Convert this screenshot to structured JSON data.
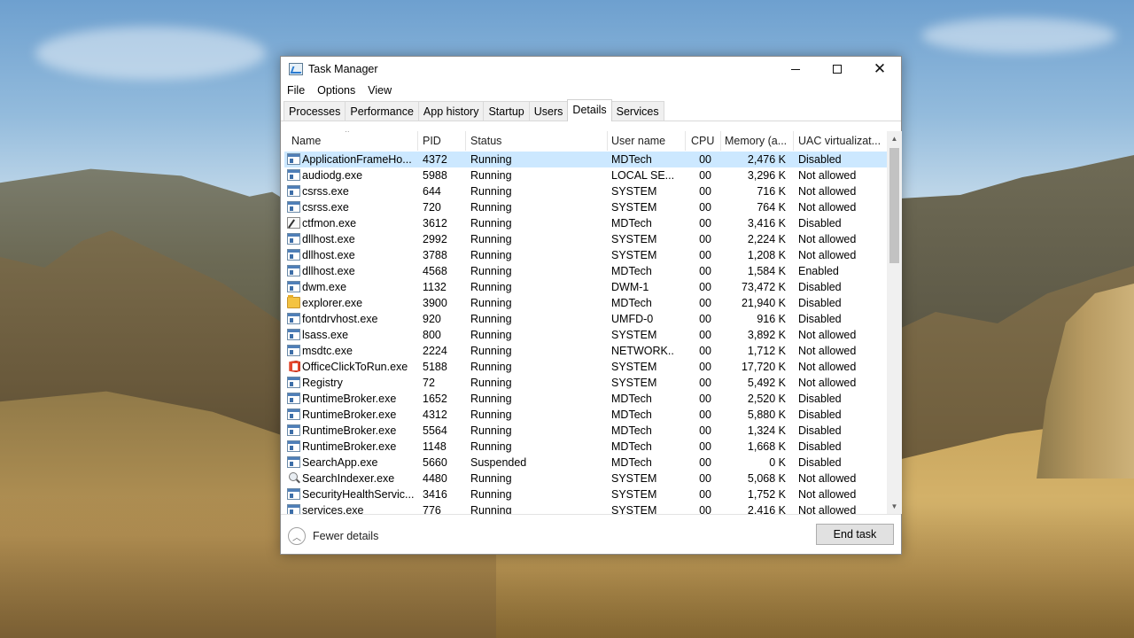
{
  "window": {
    "title": "Task Manager",
    "controls": {
      "minimize": "—",
      "maximize": "☐",
      "close": "✕"
    }
  },
  "menu": [
    "File",
    "Options",
    "View"
  ],
  "tabs": [
    {
      "label": "Processes",
      "active": false
    },
    {
      "label": "Performance",
      "active": false
    },
    {
      "label": "App history",
      "active": false
    },
    {
      "label": "Startup",
      "active": false
    },
    {
      "label": "Users",
      "active": false
    },
    {
      "label": "Details",
      "active": true
    },
    {
      "label": "Services",
      "active": false
    }
  ],
  "columns": {
    "name": "Name",
    "pid": "PID",
    "status": "Status",
    "user": "User name",
    "cpu": "CPU",
    "memory": "Memory (a...",
    "uac": "UAC virtualizat..."
  },
  "sort": {
    "column": "name",
    "direction": "ascending"
  },
  "rows": [
    {
      "name": "ApplicationFrameHo...",
      "pid": "4372",
      "status": "Running",
      "user": "MDTech",
      "cpu": "00",
      "memory": "2,476 K",
      "uac": "Disabled",
      "icon": "exe",
      "selected": true
    },
    {
      "name": "audiodg.exe",
      "pid": "5988",
      "status": "Running",
      "user": "LOCAL SE...",
      "cpu": "00",
      "memory": "3,296 K",
      "uac": "Not allowed",
      "icon": "exe"
    },
    {
      "name": "csrss.exe",
      "pid": "644",
      "status": "Running",
      "user": "SYSTEM",
      "cpu": "00",
      "memory": "716 K",
      "uac": "Not allowed",
      "icon": "exe"
    },
    {
      "name": "csrss.exe",
      "pid": "720",
      "status": "Running",
      "user": "SYSTEM",
      "cpu": "00",
      "memory": "764 K",
      "uac": "Not allowed",
      "icon": "exe"
    },
    {
      "name": "ctfmon.exe",
      "pid": "3612",
      "status": "Running",
      "user": "MDTech",
      "cpu": "00",
      "memory": "3,416 K",
      "uac": "Disabled",
      "icon": "ctf"
    },
    {
      "name": "dllhost.exe",
      "pid": "2992",
      "status": "Running",
      "user": "SYSTEM",
      "cpu": "00",
      "memory": "2,224 K",
      "uac": "Not allowed",
      "icon": "exe"
    },
    {
      "name": "dllhost.exe",
      "pid": "3788",
      "status": "Running",
      "user": "SYSTEM",
      "cpu": "00",
      "memory": "1,208 K",
      "uac": "Not allowed",
      "icon": "exe"
    },
    {
      "name": "dllhost.exe",
      "pid": "4568",
      "status": "Running",
      "user": "MDTech",
      "cpu": "00",
      "memory": "1,584 K",
      "uac": "Enabled",
      "icon": "exe"
    },
    {
      "name": "dwm.exe",
      "pid": "1132",
      "status": "Running",
      "user": "DWM-1",
      "cpu": "00",
      "memory": "73,472 K",
      "uac": "Disabled",
      "icon": "exe"
    },
    {
      "name": "explorer.exe",
      "pid": "3900",
      "status": "Running",
      "user": "MDTech",
      "cpu": "00",
      "memory": "21,940 K",
      "uac": "Disabled",
      "icon": "folder"
    },
    {
      "name": "fontdrvhost.exe",
      "pid": "920",
      "status": "Running",
      "user": "UMFD-0",
      "cpu": "00",
      "memory": "916 K",
      "uac": "Disabled",
      "icon": "exe"
    },
    {
      "name": "lsass.exe",
      "pid": "800",
      "status": "Running",
      "user": "SYSTEM",
      "cpu": "00",
      "memory": "3,892 K",
      "uac": "Not allowed",
      "icon": "exe"
    },
    {
      "name": "msdtc.exe",
      "pid": "2224",
      "status": "Running",
      "user": "NETWORK...",
      "cpu": "00",
      "memory": "1,712 K",
      "uac": "Not allowed",
      "icon": "exe"
    },
    {
      "name": "OfficeClickToRun.exe",
      "pid": "5188",
      "status": "Running",
      "user": "SYSTEM",
      "cpu": "00",
      "memory": "17,720 K",
      "uac": "Not allowed",
      "icon": "office"
    },
    {
      "name": "Registry",
      "pid": "72",
      "status": "Running",
      "user": "SYSTEM",
      "cpu": "00",
      "memory": "5,492 K",
      "uac": "Not allowed",
      "icon": "exe"
    },
    {
      "name": "RuntimeBroker.exe",
      "pid": "1652",
      "status": "Running",
      "user": "MDTech",
      "cpu": "00",
      "memory": "2,520 K",
      "uac": "Disabled",
      "icon": "exe"
    },
    {
      "name": "RuntimeBroker.exe",
      "pid": "4312",
      "status": "Running",
      "user": "MDTech",
      "cpu": "00",
      "memory": "5,880 K",
      "uac": "Disabled",
      "icon": "exe"
    },
    {
      "name": "RuntimeBroker.exe",
      "pid": "5564",
      "status": "Running",
      "user": "MDTech",
      "cpu": "00",
      "memory": "1,324 K",
      "uac": "Disabled",
      "icon": "exe"
    },
    {
      "name": "RuntimeBroker.exe",
      "pid": "1148",
      "status": "Running",
      "user": "MDTech",
      "cpu": "00",
      "memory": "1,668 K",
      "uac": "Disabled",
      "icon": "exe"
    },
    {
      "name": "SearchApp.exe",
      "pid": "5660",
      "status": "Suspended",
      "user": "MDTech",
      "cpu": "00",
      "memory": "0 K",
      "uac": "Disabled",
      "icon": "exe"
    },
    {
      "name": "SearchIndexer.exe",
      "pid": "4480",
      "status": "Running",
      "user": "SYSTEM",
      "cpu": "00",
      "memory": "5,068 K",
      "uac": "Not allowed",
      "icon": "search"
    },
    {
      "name": "SecurityHealthServic...",
      "pid": "3416",
      "status": "Running",
      "user": "SYSTEM",
      "cpu": "00",
      "memory": "1,752 K",
      "uac": "Not allowed",
      "icon": "exe"
    },
    {
      "name": "services.exe",
      "pid": "776",
      "status": "Running",
      "user": "SYSTEM",
      "cpu": "00",
      "memory": "2,416 K",
      "uac": "Not allowed",
      "icon": "exe"
    }
  ],
  "footer": {
    "fewer_details": "Fewer details",
    "end_task": "End task"
  },
  "colors": {
    "selection": "#cce8ff",
    "accent": "#0078d7"
  }
}
